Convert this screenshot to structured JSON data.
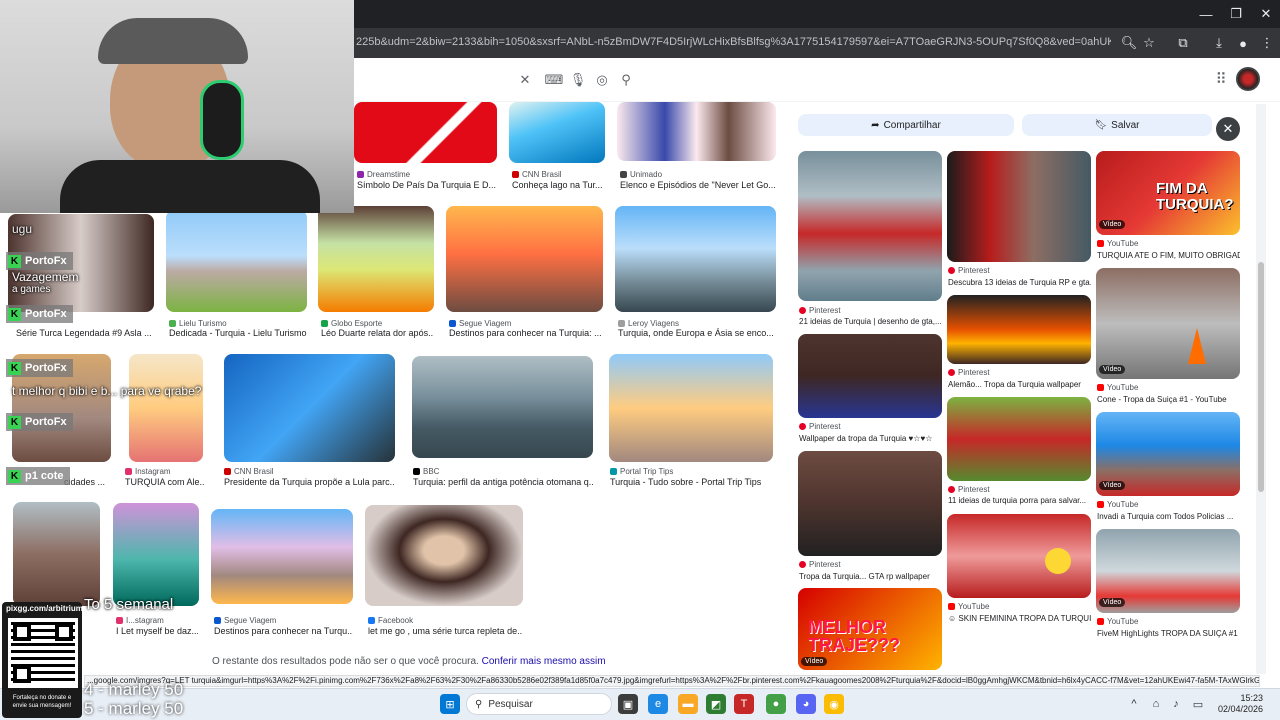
{
  "browser": {
    "url": "225b&udm=2&biw=2133&bih=1050&sxsrf=ANbL-n5zBmDW7F4D5IrjWLcHixBfsBlfsg%3A1775154179597&ei=A7TOaeGRJN3-5OUPq7Sf0Q8&ved=0ahUKEwihn6_S5M-TAxVdP7kGHS..."
  },
  "grid": {
    "row0": [
      {
        "source": "Dreamstime",
        "title": "Símbolo De País Da Turquia E D...",
        "color": "#8e24aa"
      },
      {
        "source": "CNN Brasil",
        "title": "Conheça lago na Tur...",
        "color": "#cc0000"
      },
      {
        "source": "Unimado",
        "title": "Elenco e Episódios de \"Never Let Go...",
        "color": "#444444"
      }
    ],
    "row1": [
      {
        "source": "",
        "title": "Série Turca Legendada #9 Asla ...",
        "color": "#888888"
      },
      {
        "source": "Lielu Turismo",
        "title": "Dedicada - Turquia - Lielu Turismo",
        "color": "#4caf50"
      },
      {
        "source": "Globo Esporte",
        "title": "Léo Duarte relata dor após...",
        "color": "#16a34a"
      },
      {
        "source": "Segue Viagem",
        "title": "Destinos para conhecer na Turquia: ...",
        "color": "#0b57d0"
      },
      {
        "source": "Leroy Viagens",
        "title": "Turquia, onde Europa e Ásia se enco...",
        "color": "#9e9e9e"
      }
    ],
    "row2": [
      {
        "source": "",
        "title": "cidades ...",
        "color": "#888888"
      },
      {
        "source": "Instagram",
        "title": "TURQUIA com Ale...",
        "color": "#e1306c"
      },
      {
        "source": "CNN Brasil",
        "title": "Presidente da Turquia propõe a Lula parc...",
        "color": "#cc0000"
      },
      {
        "source": "BBC",
        "title": "Turquia: perfil da antiga potência otomana q...",
        "color": "#000000"
      },
      {
        "source": "Portal Trip Tips",
        "title": "Turquia - Tudo sobre - Portal Trip Tips",
        "color": "#0097a7"
      }
    ],
    "row3": [
      {
        "source": "",
        "title": "",
        "color": "#888888"
      },
      {
        "source": "I...stagram",
        "title": "I Let myself be daz...",
        "color": "#e1306c"
      },
      {
        "source": "Segue Viagem",
        "title": "Destinos para conhecer na Turqu...",
        "color": "#0b57d0"
      },
      {
        "source": "Facebook",
        "title": "let me go , uma série turca repleta de...",
        "color": "#1877f2"
      }
    ],
    "bottom_note": "O restante dos resultados pode não ser o que você procura.",
    "bottom_link": "Conferir mais mesmo assim"
  },
  "panel": {
    "share_label": "Compartilhar",
    "save_label": "Salvar",
    "video_badge": "Vídeo",
    "col1": [
      {
        "source": "Pinterest",
        "title": "21 ideias de Turquia | desenho de gta,...",
        "color": "#e60023"
      },
      {
        "source": "Pinterest",
        "title": "Wallpaper da tropa da Turquia ♥☆♥☆",
        "color": "#e60023"
      },
      {
        "source": "Pinterest",
        "title": "Tropa da Turquia... GTA rp wallpaper",
        "color": "#e60023"
      }
    ],
    "col2": [
      {
        "source": "Pinterest",
        "title": "Descubra 13 ideias de Turquia RP e gta...",
        "color": "#e60023"
      },
      {
        "source": "Pinterest",
        "title": "Alemão... Tropa da Turquia wallpaper",
        "color": "#e60023"
      },
      {
        "source": "Pinterest",
        "title": "11 ideias de turquia porra para salvar...",
        "color": "#e60023"
      },
      {
        "source": "YouTube",
        "title": "☺ SKIN FEMININA TROPA DA TURQUIA...",
        "color": "#ff0000"
      }
    ],
    "col3": [
      {
        "source": "YouTube",
        "title": "TURQUIA ATE O FIM, MUITO OBRIGADO...",
        "color": "#ff0000"
      },
      {
        "source": "YouTube",
        "title": "Cone - Tropa da Suiça #1 - YouTube",
        "color": "#ff0000"
      },
      {
        "source": "YouTube",
        "title": "Invadi a Turquia com Todos Policias ...",
        "color": "#ff0000"
      },
      {
        "source": "YouTube",
        "title": "FiveM HighLights TROPA DA SUIÇA #1",
        "color": "#ff0000"
      }
    ],
    "thumb_text": {
      "fim": "FIM DA TURQUIA?",
      "melhor": "MELHOR TRAJE???"
    }
  },
  "statusbar_url": "...google.com/imgres?q=LET turquia&imgurl=https%3A%2F%2Fi.pinimg.com%2F736x%2Fa8%2F63%2F30%2Fa86330b5286e02f389fa1d85f0a7c479.jpg&imgrefurl=https%3A%2F%2Fbr.pinterest.com%2Fkauagoomes2008%2Fturquia%2F&docid=lB0ggAmhgjWKCM&tbnid=h6lx4yCACC-f7M&vet=12ahUKEwi47-fa5M-TAxWGlrkGHXMbJVgQnP...",
  "taskbar": {
    "search_label": "Pesquisar",
    "time": "15:23",
    "date": "02/04/2026"
  },
  "overlay": {
    "brand": "PortoFx",
    "chat_lines": [
      "ugu",
      "Vazagemem",
      "a games",
      "t melhor q bibi e b... para ve qrabe?",
      "p1 cote",
      "To 5 semanal"
    ],
    "qr_site": "pixgg.com/arbitrium",
    "qr_caption": "Fortaleça no donate e envie sua mensagem!",
    "ticker1": "4 - marley 50",
    "ticker2": "5 - marley 50"
  }
}
